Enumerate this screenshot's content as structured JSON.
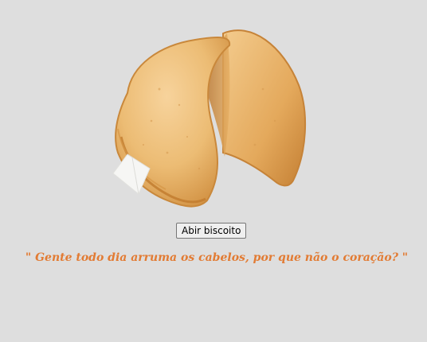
{
  "page": {
    "cookie_image_name": "fortune-cookie-image",
    "button_label": "Abir biscoito",
    "fortune": "\" Gente todo dia arruma os cabelos, por que não o coração? \""
  },
  "colors": {
    "background": "#dedede",
    "fortune_text": "#e27b33",
    "cookie_base": "#e9b468",
    "cookie_edge": "#c8873c"
  }
}
